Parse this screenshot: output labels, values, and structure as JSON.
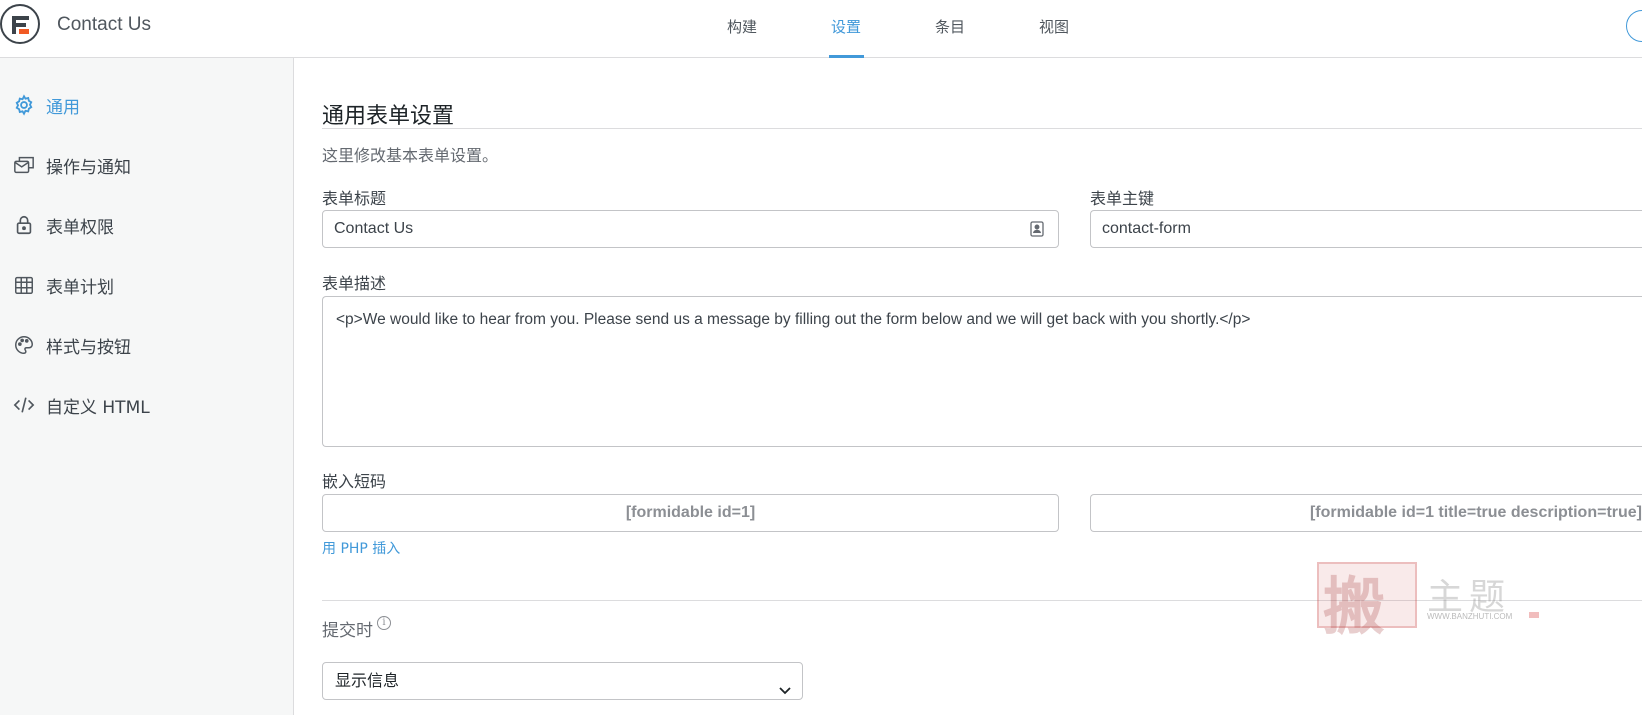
{
  "header": {
    "app_title": "Contact Us",
    "tabs": [
      {
        "label": "构建",
        "active": false
      },
      {
        "label": "设置",
        "active": true
      },
      {
        "label": "条目",
        "active": false
      },
      {
        "label": "视图",
        "active": false
      }
    ],
    "accent_color": "#4199d9"
  },
  "sidebar": {
    "items": [
      {
        "label": "通用",
        "icon": "gear-icon",
        "active": true
      },
      {
        "label": "操作与通知",
        "icon": "mail-actions-icon",
        "active": false
      },
      {
        "label": "表单权限",
        "icon": "lock-icon",
        "active": false
      },
      {
        "label": "表单计划",
        "icon": "calendar-icon",
        "active": false
      },
      {
        "label": "样式与按钮",
        "icon": "palette-icon",
        "active": false
      },
      {
        "label": "自定义 HTML",
        "icon": "code-icon",
        "active": false
      }
    ]
  },
  "main": {
    "heading": "通用表单设置",
    "subheading": "这里修改基本表单设置。",
    "form_title_label": "表单标题",
    "form_title_value": "Contact Us",
    "form_key_label": "表单主键",
    "form_key_value": "contact-form",
    "form_desc_label": "表单描述",
    "form_desc_value": "<p>We would like to hear from you. Please send us a message by filling out the form below and we will get back with you shortly.</p>",
    "embed_label": "嵌入短码",
    "shortcode_1": "[formidable id=1]",
    "shortcode_2": "[formidable id=1 title=true description=true]",
    "php_link": "用 PHP 插入",
    "on_submit_label": "提交时",
    "on_submit_select": "显示信息"
  },
  "watermark": {
    "char": "搬",
    "text": "主题",
    "url": "WWW.BANZHUTI.COM"
  }
}
